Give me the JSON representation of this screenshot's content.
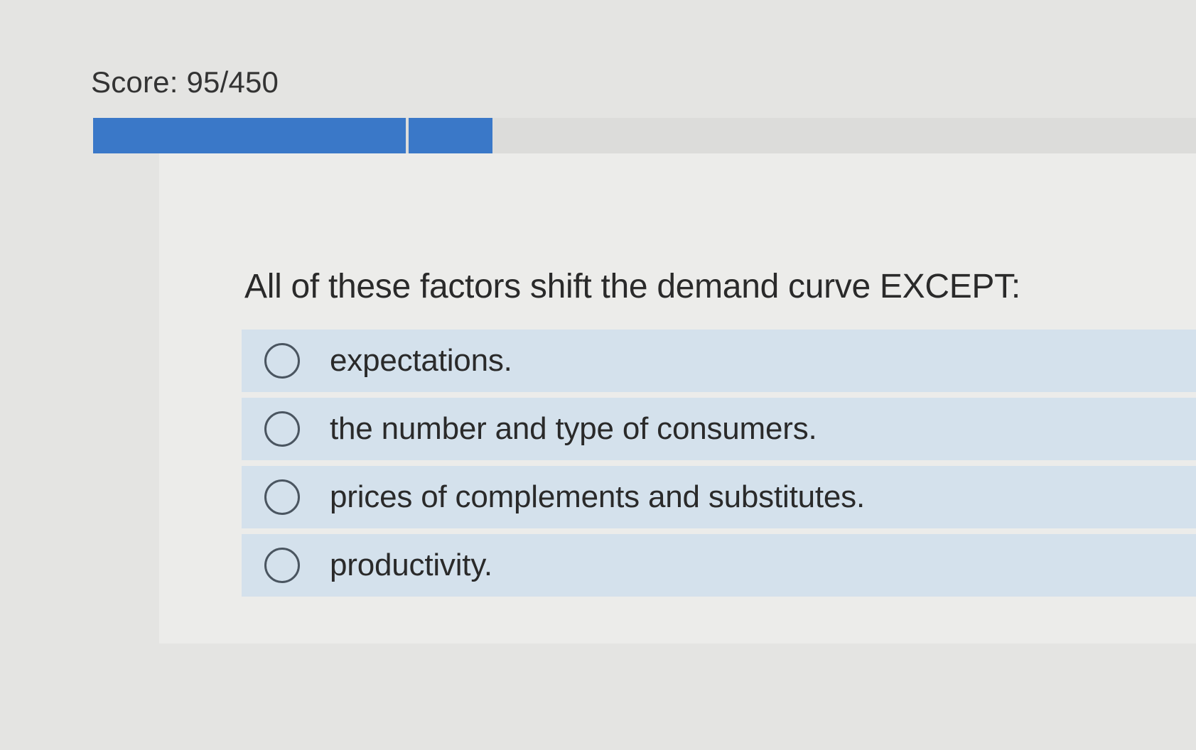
{
  "score": {
    "label": "Score: 95/450",
    "progress_fraction": 0.3
  },
  "question": {
    "prompt": "All of these factors shift the demand curve EXCEPT:",
    "options": [
      {
        "label": "expectations.",
        "selected": false
      },
      {
        "label": "the number and type of consumers.",
        "selected": false
      },
      {
        "label": "prices of complements and substitutes.",
        "selected": false
      },
      {
        "label": "productivity.",
        "selected": false
      }
    ]
  },
  "colors": {
    "progress_fill": "#3a78c8",
    "option_background": "#d4e1ec",
    "page_background": "#e4e4e2"
  }
}
